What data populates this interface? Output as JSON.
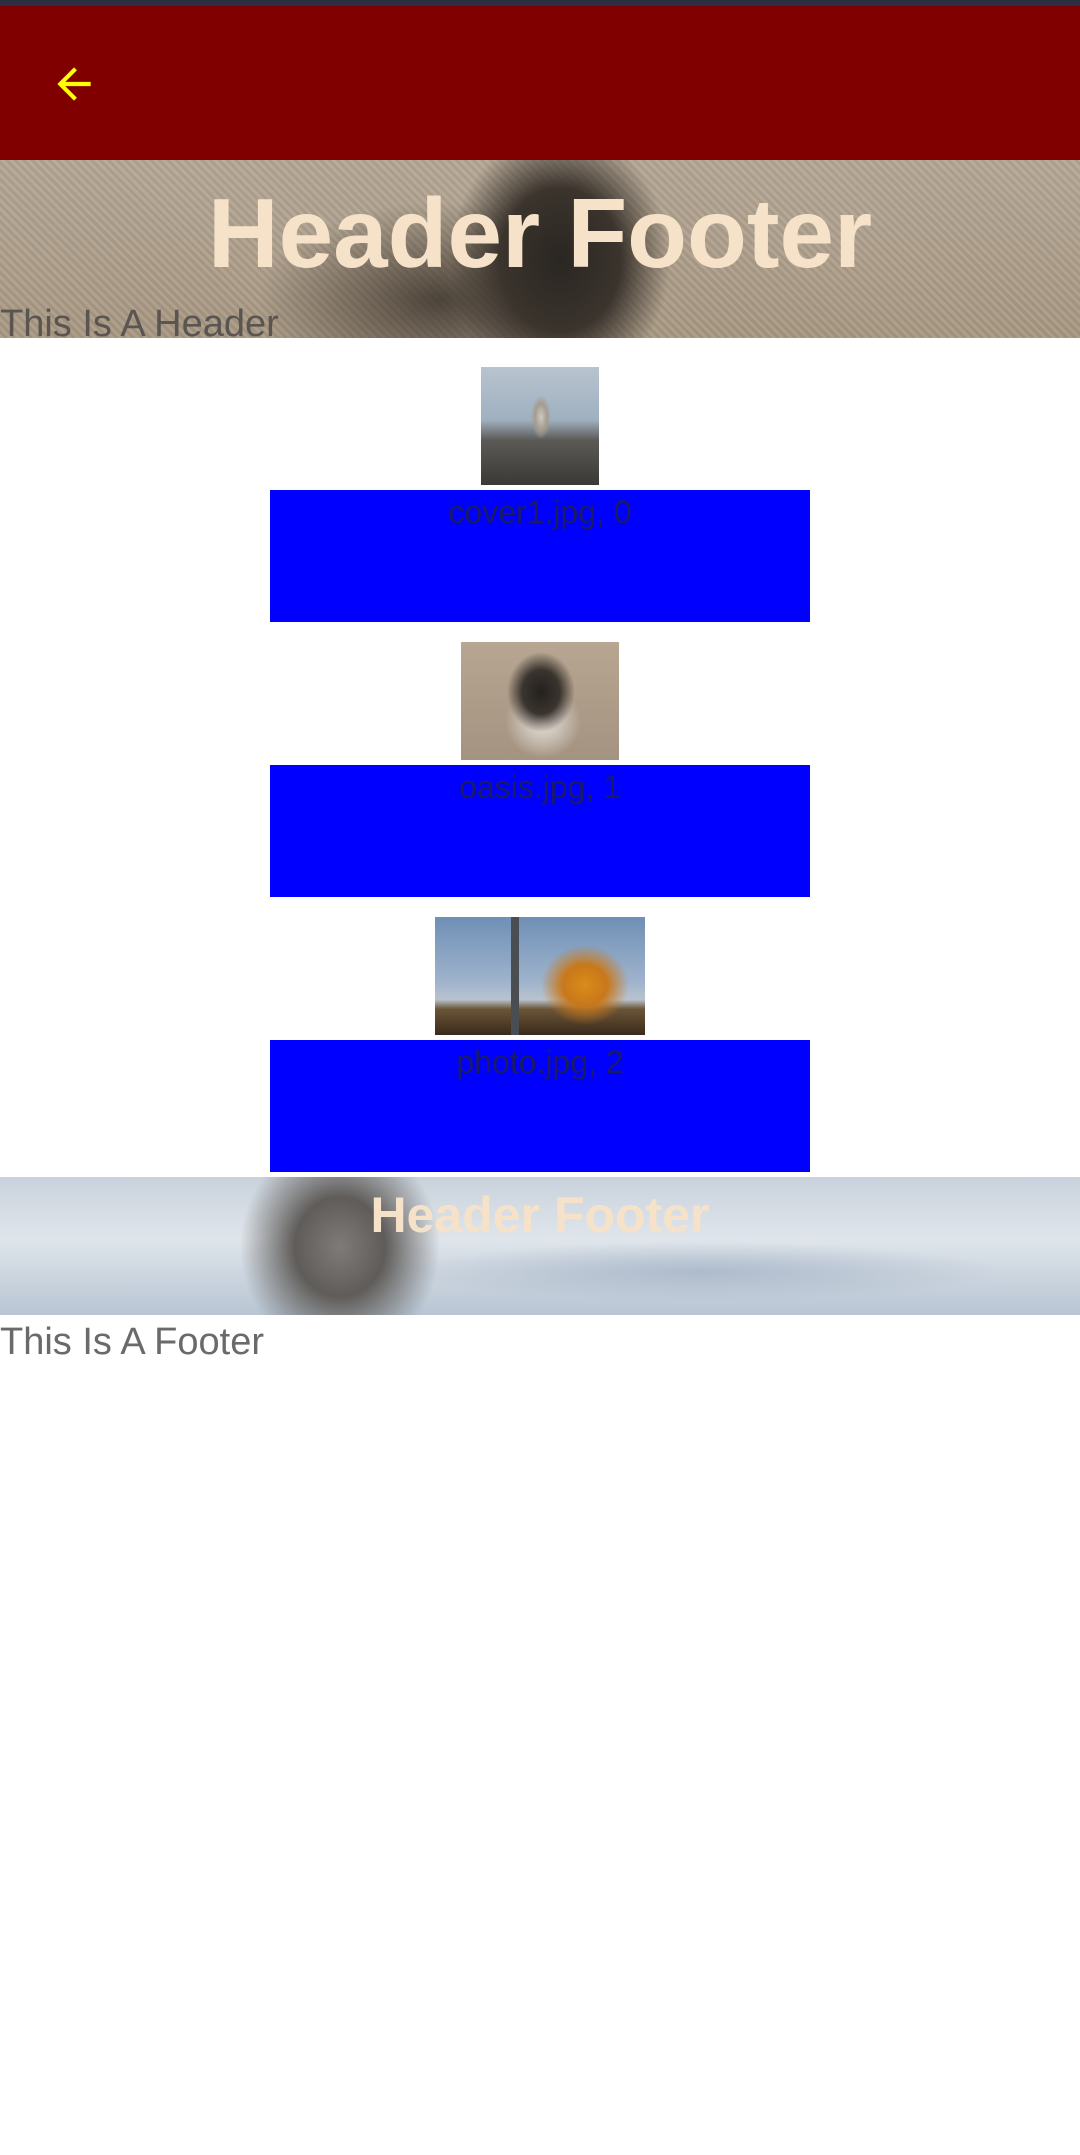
{
  "app_bar": {
    "back_icon": "arrow-back-icon",
    "icon_color": "#ffff00",
    "background_color": "#800000"
  },
  "header": {
    "title": "Header Footer",
    "subtitle": "This Is A Header",
    "title_color": "#f6e2c8"
  },
  "items": [
    {
      "label": "cover1.jpg, 0"
    },
    {
      "label": "oasis.jpg, 1"
    },
    {
      "label": "photo.jpg, 2"
    }
  ],
  "item_box_color": "#0000ff",
  "footer": {
    "title": "Header Footer",
    "subtitle": "This Is A Footer"
  }
}
